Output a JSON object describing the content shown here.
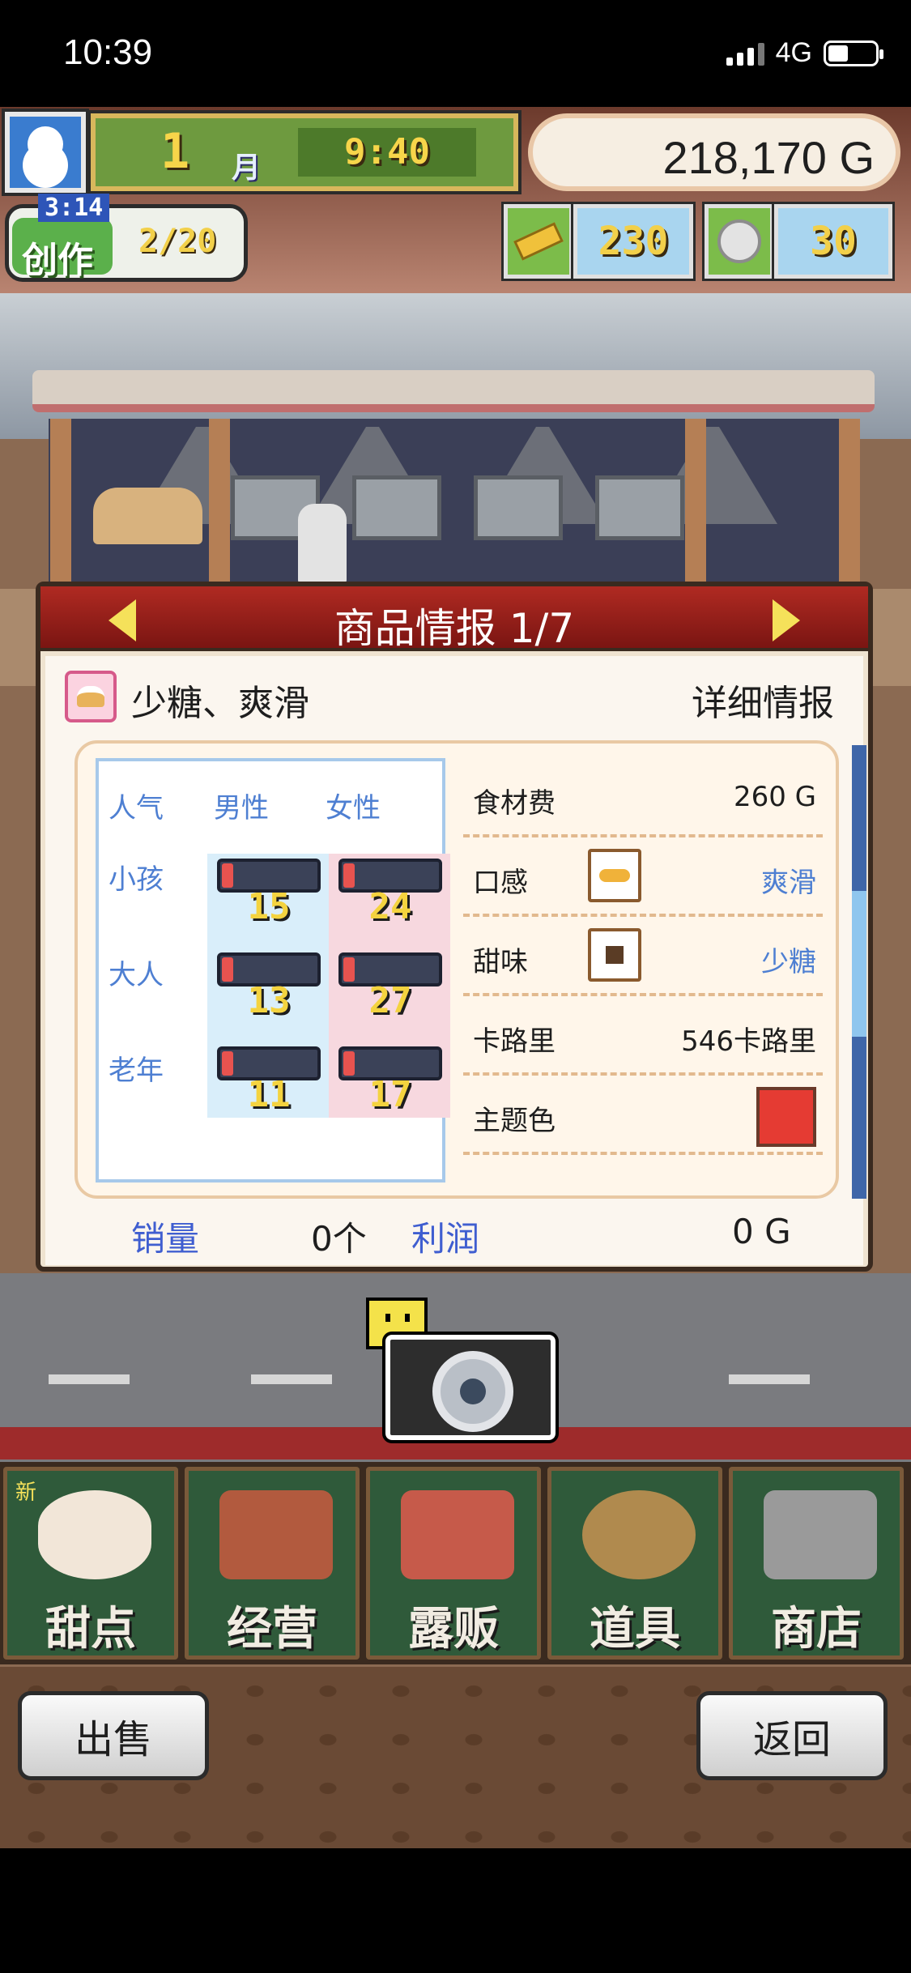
{
  "status_bar": {
    "time": "10:39",
    "network": "4G"
  },
  "hud": {
    "month": "1",
    "month_label": "月",
    "clock": "9:40",
    "money": "218,170 G",
    "create": {
      "timer": "3:14",
      "label": "创作",
      "count": "2/20"
    },
    "gold": "230",
    "medal": "30"
  },
  "panel": {
    "title": "商品情报 1/7",
    "product_name": "少糖、爽滑",
    "detail_link": "详细情报",
    "popularity": {
      "headers": [
        "人气",
        "男性",
        "女性"
      ],
      "rows": [
        {
          "label": "小孩",
          "male": "15",
          "female": "24"
        },
        {
          "label": "大人",
          "male": "13",
          "female": "27"
        },
        {
          "label": "老年",
          "male": "11",
          "female": "17"
        }
      ]
    },
    "info": {
      "ingredient_cost_label": "食材费",
      "ingredient_cost": "260 G",
      "texture_label": "口感",
      "texture_value": "爽滑",
      "sweetness_label": "甜味",
      "sweetness_value": "少糖",
      "calories_label": "卡路里",
      "calories_value": "546卡路里",
      "theme_color_label": "主题色",
      "theme_color": "#e53b33"
    },
    "footer": {
      "sales_label": "销量",
      "sales_value": "0个",
      "profit_label": "利润",
      "profit_value": "0 G"
    }
  },
  "menu": {
    "items": [
      {
        "label": "甜点",
        "badge": "新"
      },
      {
        "label": "经营"
      },
      {
        "label": "露贩"
      },
      {
        "label": "道具"
      },
      {
        "label": "商店"
      }
    ]
  },
  "buttons": {
    "sell": "出售",
    "back": "返回"
  }
}
